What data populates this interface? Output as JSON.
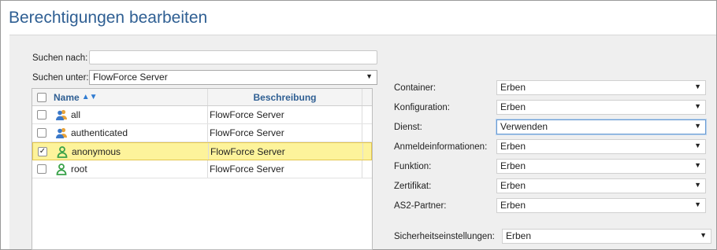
{
  "page": {
    "title": "Berechtigungen bearbeiten"
  },
  "search": {
    "label": "Suchen nach:",
    "value": ""
  },
  "search_in": {
    "label": "Suchen unter:",
    "value": "FlowForce Server"
  },
  "table": {
    "col_name": "Name",
    "col_desc": "Beschreibung",
    "rows": [
      {
        "name": "all",
        "description": "FlowForce Server",
        "checked": false,
        "icon": "group-icon"
      },
      {
        "name": "authenticated",
        "description": "FlowForce Server",
        "checked": false,
        "icon": "group-icon"
      },
      {
        "name": "anonymous",
        "description": "FlowForce Server",
        "checked": true,
        "icon": "user-icon"
      },
      {
        "name": "root",
        "description": "FlowForce Server",
        "checked": false,
        "icon": "user-icon"
      }
    ]
  },
  "permissions": [
    {
      "label": "Container:",
      "value": "Erben"
    },
    {
      "label": "Konfiguration:",
      "value": "Erben"
    },
    {
      "label": "Dienst:",
      "value": "Verwenden"
    },
    {
      "label": "Anmeldeinformationen:",
      "value": "Erben"
    },
    {
      "label": "Funktion:",
      "value": "Erben"
    },
    {
      "label": "Zertifikat:",
      "value": "Erben"
    },
    {
      "label": "AS2-Partner:",
      "value": "Erben"
    }
  ],
  "security": {
    "label": "Sicherheitseinstellungen:",
    "value": "Erben"
  },
  "colors": {
    "title": "#2f5f93",
    "header_text": "#2f5f93",
    "selected_row": "#fdf39b",
    "focus_border": "#6b9bd2",
    "group_icon_blue": "#3a78c9",
    "user_icon_green": "#3aa24a"
  },
  "glyphs": {
    "caret": "▼",
    "sort_asc": "▲▼",
    "check": "✓"
  }
}
